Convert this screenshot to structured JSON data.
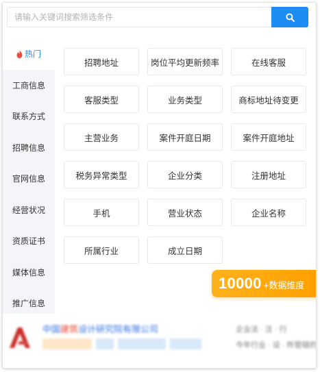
{
  "search": {
    "placeholder": "请输入关键词搜索筛选条件",
    "button_icon": "search-icon"
  },
  "sidebar": {
    "items": [
      {
        "label": "热门",
        "icon": "flame-icon",
        "active": true
      },
      {
        "label": "工商信息"
      },
      {
        "label": "联系方式"
      },
      {
        "label": "招聘信息"
      },
      {
        "label": "官网信息"
      },
      {
        "label": "经营状况"
      },
      {
        "label": "资质证书"
      },
      {
        "label": "媒体信息"
      },
      {
        "label": "推广信息"
      }
    ]
  },
  "tags": [
    "招聘地址",
    "岗位平均更新频率",
    "在线客服",
    "客服类型",
    "业务类型",
    "商标地址待变更",
    "主营业务",
    "案件开庭日期",
    "案件开庭地址",
    "税务异常类型",
    "企业分类",
    "注册地址",
    "手机",
    "营业状态",
    "企业名称",
    "所属行业",
    "成立日期"
  ],
  "badge": {
    "number": "10000",
    "suffix": "+数据维度"
  },
  "preview": {
    "company_prefix": "中国",
    "company_highlight": "建筑",
    "company_rest": "设计研究院有限公司",
    "right_line_1": "企业法 · 注 · 行",
    "right_line_2": "今年行业 · 设 · 所管辖的"
  },
  "colors": {
    "accent": "#1d8cf3",
    "badge": "#ffa000",
    "sidebar_bg": "#f3f5f8",
    "flame": "#f04b3a"
  }
}
